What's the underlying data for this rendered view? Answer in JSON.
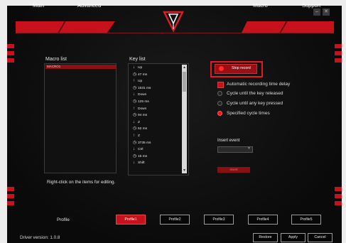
{
  "header": {
    "tabs_left": [
      "Main",
      "Advanced"
    ],
    "tabs_right": [
      "Macro",
      "Support"
    ],
    "active_tab": "Macro",
    "window_buttons": [
      "‒",
      "✕"
    ]
  },
  "macro_list": {
    "title": "Macro list",
    "items": [
      "MACRO1"
    ]
  },
  "key_list": {
    "title": "Key list",
    "items": [
      {
        "icon": "arrow-down",
        "glyph": "↓",
        "text": "Up"
      },
      {
        "icon": "clock",
        "glyph": "◷",
        "text": "47 ms"
      },
      {
        "icon": "arrow-up",
        "glyph": "↑",
        "text": "Up"
      },
      {
        "icon": "clock",
        "glyph": "◷",
        "text": "1531 ms"
      },
      {
        "icon": "arrow-down",
        "glyph": "↓",
        "text": "Down"
      },
      {
        "icon": "clock",
        "glyph": "◷",
        "text": "125 ms"
      },
      {
        "icon": "arrow-up",
        "glyph": "↑",
        "text": "Down"
      },
      {
        "icon": "clock",
        "glyph": "◷",
        "text": "94 ms"
      },
      {
        "icon": "arrow-down",
        "glyph": "↓",
        "text": "Z"
      },
      {
        "icon": "clock",
        "glyph": "◷",
        "text": "62 ms"
      },
      {
        "icon": "arrow-up",
        "glyph": "↑",
        "text": "Z"
      },
      {
        "icon": "clock",
        "glyph": "◷",
        "text": "3735 ms"
      },
      {
        "icon": "arrow-down",
        "glyph": "↓",
        "text": "Ctrl"
      },
      {
        "icon": "clock",
        "glyph": "◷",
        "text": "15 ms"
      },
      {
        "icon": "arrow-down",
        "glyph": "↓",
        "text": "Shift"
      }
    ]
  },
  "record": {
    "stop_label": "Stop record"
  },
  "options": {
    "auto_delay_label": "Automatic recording time delay",
    "auto_delay_checked": true,
    "cycle_options": [
      {
        "label": "Cycle until the key released",
        "selected": false
      },
      {
        "label": "Cycle until any key pressed",
        "selected": false
      },
      {
        "label": "Specified cycle times",
        "selected": true
      }
    ]
  },
  "insert_event": {
    "label": "Insert event",
    "button_label": "Insert"
  },
  "hint": "Right-click on the items for editing.",
  "profile": {
    "label": "Profile",
    "items": [
      "Profile1",
      "Profile2",
      "Profile3",
      "Profile4",
      "Profile5"
    ],
    "active": "Profile1"
  },
  "footer": {
    "driver_version": "Driver version:  1.0.8",
    "restore_label": "Restore",
    "apply_label": "Apply",
    "cancel_label": "Cancel"
  },
  "colors": {
    "accent": "#c8121b",
    "background": "#0b0b0b",
    "text": "#e6e6e6"
  }
}
